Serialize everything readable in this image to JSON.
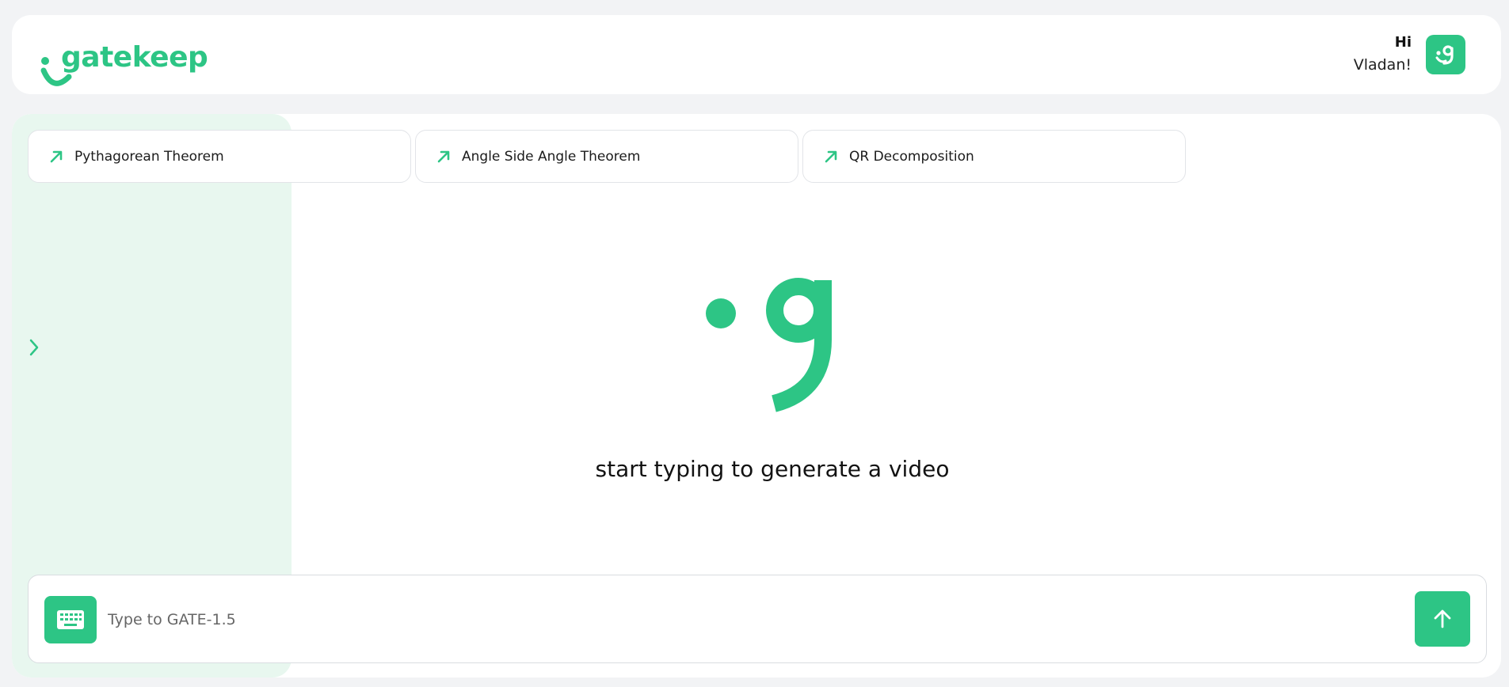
{
  "app": {
    "brand": "gatekeep",
    "accent_color": "#2dc585"
  },
  "header": {
    "greeting_hi": "Hi",
    "greeting_name": "Vladan!",
    "avatar_icon": "gatekeep-smile-icon"
  },
  "sidebar": {
    "toggle_icon": "chevron-right-icon"
  },
  "suggestions": [
    {
      "label": "Pythagorean Theorem",
      "icon": "arrow-up-right-icon"
    },
    {
      "label": "Angle Side Angle Theorem",
      "icon": "arrow-up-right-icon"
    },
    {
      "label": "QR Decomposition",
      "icon": "arrow-up-right-icon"
    }
  ],
  "empty_state": {
    "message": "start typing to generate a video",
    "icon": "gatekeep-g-logo"
  },
  "composer": {
    "placeholder": "Type to GATE-1.5",
    "value": "",
    "keyboard_icon": "keyboard-icon",
    "send_icon": "arrow-up-icon"
  }
}
